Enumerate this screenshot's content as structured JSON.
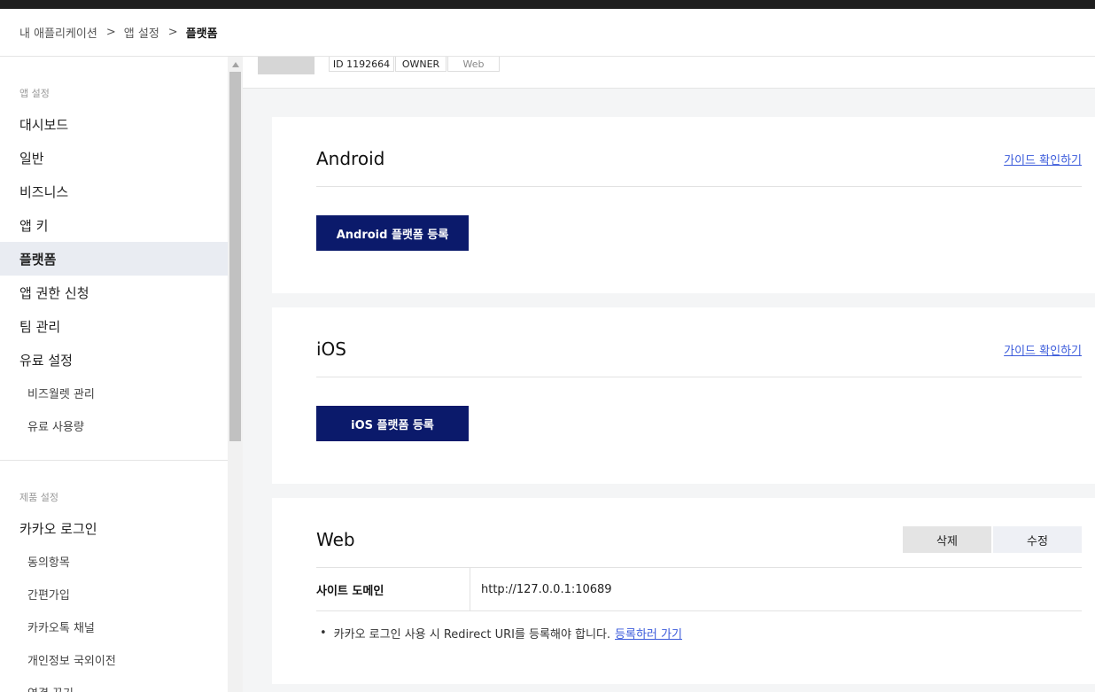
{
  "breadcrumb": {
    "items": [
      "내 애플리케이션",
      "앱 설정",
      "플랫폼"
    ],
    "separator": ">"
  },
  "sidebar": {
    "section1_label": "앱 설정",
    "items": [
      "대시보드",
      "일반",
      "비즈니스",
      "앱 키",
      "플랫폼",
      "앱 권한 신청",
      "팀 관리",
      "유료 설정"
    ],
    "sub_items": [
      "비즈월렛 관리",
      "유료 사용량"
    ],
    "section2_label": "제품 설정",
    "product_item": "카카오 로그인",
    "product_sub_items": [
      "동의항목",
      "간편가입",
      "카카오톡 채널",
      "개인정보 국외이전",
      "연결 끊기"
    ],
    "active_item": "플랫폼"
  },
  "app_header": {
    "tags": [
      "ID 1192664",
      "OWNER",
      "Web"
    ]
  },
  "sections": {
    "android": {
      "title": "Android",
      "guide_link": "가이드 확인하기",
      "register_button": "Android 플랫폼 등록"
    },
    "ios": {
      "title": "iOS",
      "guide_link": "가이드 확인하기",
      "register_button": "iOS 플랫폼 등록"
    },
    "web": {
      "title": "Web",
      "delete_button": "삭제",
      "edit_button": "수정",
      "site_domain_label": "사이트 도메인",
      "site_domain_value": "http://127.0.0.1:10689",
      "note_text": "카카오 로그인 사용 시 Redirect URI를 등록해야 합니다.",
      "note_link": "등록하러 가기"
    }
  },
  "colors": {
    "primary_button": "#0b1a6b",
    "link": "#3b5bdb",
    "active_sidebar_bg": "#e9ecf2"
  }
}
